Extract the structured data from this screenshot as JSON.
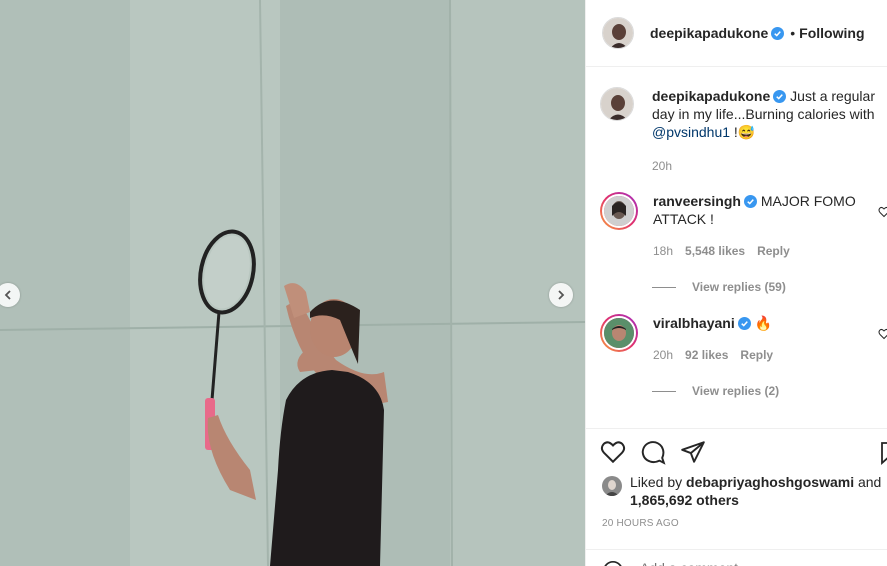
{
  "post": {
    "author": "deepikapadukone",
    "follow_status": "Following",
    "caption_text": "Just a regular day in my life...Burning calories with ",
    "caption_mention": "@pvsindhu1",
    "caption_tail": " !😅",
    "caption_age": "20h"
  },
  "comments": [
    {
      "username": "ranveersingh",
      "text": "MAJOR FOMO ATTACK !",
      "age": "18h",
      "likes": "5,548 likes",
      "reply_label": "Reply",
      "view_replies": "View replies (59)"
    },
    {
      "username": "viralbhayani",
      "text": "🔥",
      "age": "20h",
      "likes": "92 likes",
      "reply_label": "Reply",
      "view_replies": "View replies (2)"
    }
  ],
  "likes_summary": {
    "prefix": "Liked by ",
    "user": "debapriyaghoshgoswami",
    "mid": " and ",
    "count": "1,865,692 others"
  },
  "timestamp": "20 HOURS AGO",
  "comment_input": {
    "placeholder": "Add a comment..."
  },
  "colors": {
    "verified": "#3897f0",
    "link": "#00376b",
    "muted": "#8e8e8e"
  },
  "icons": [
    "heart-icon",
    "comment-icon",
    "share-icon",
    "save-icon",
    "emoji-icon",
    "chevron-left-icon",
    "chevron-right-icon",
    "verified-icon"
  ]
}
